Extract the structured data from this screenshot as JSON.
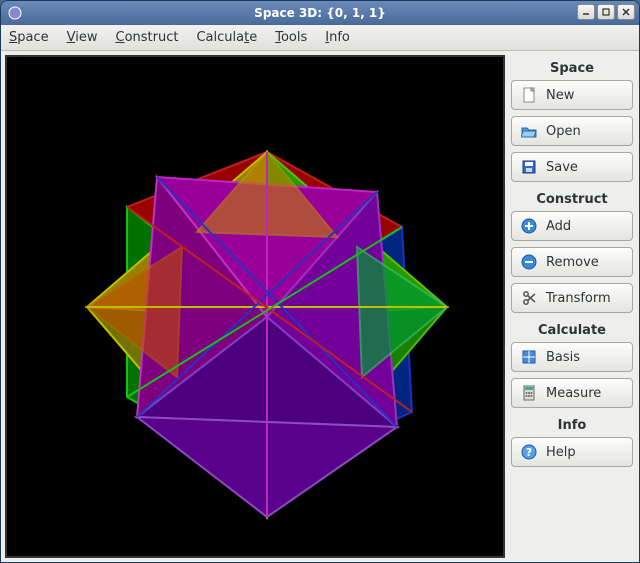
{
  "window": {
    "title": "Space 3D: {0, 1, 1}"
  },
  "menubar": [
    {
      "full": "Space",
      "accel": "S",
      "rest": "pace"
    },
    {
      "full": "View",
      "accel": "V",
      "rest": "iew"
    },
    {
      "full": "Construct",
      "accel": "C",
      "rest": "onstruct"
    },
    {
      "full": "Calculate",
      "accel": "C",
      "pre": "Cal",
      "accel2": "c",
      "rest": "ulate"
    },
    {
      "full": "Tools",
      "accel": "T",
      "rest": "ools"
    },
    {
      "full": "Info",
      "accel": "I",
      "rest": "nfo"
    }
  ],
  "sidebar": {
    "space": {
      "title": "Space",
      "new": "New",
      "open": "Open",
      "save": "Save"
    },
    "construct": {
      "title": "Construct",
      "add": "Add",
      "remove": "Remove",
      "transform": "Transform"
    },
    "calculate": {
      "title": "Calculate",
      "basis": "Basis",
      "measure": "Measure"
    },
    "info": {
      "title": "Info",
      "help": "Help"
    }
  }
}
